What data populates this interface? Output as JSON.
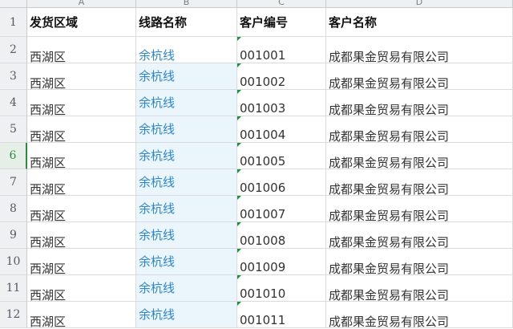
{
  "columns": [
    "A",
    "B",
    "C",
    "D"
  ],
  "headers": [
    "发货区域",
    "线路名称",
    "客户编号",
    "客户名称"
  ],
  "rows": [
    {
      "num": "2",
      "a": "西湖区",
      "b": "余杭线",
      "c": "001001",
      "d": "成都果金贸易有限公司"
    },
    {
      "num": "3",
      "a": "西湖区",
      "b": "余杭线",
      "c": "001002",
      "d": "成都果金贸易有限公司"
    },
    {
      "num": "4",
      "a": "西湖区",
      "b": "余杭线",
      "c": "001003",
      "d": "成都果金贸易有限公司"
    },
    {
      "num": "5",
      "a": "西湖区",
      "b": "余杭线",
      "c": "001004",
      "d": "成都果金贸易有限公司"
    },
    {
      "num": "6",
      "a": "西湖区",
      "b": "余杭线",
      "c": "001005",
      "d": "成都果金贸易有限公司"
    },
    {
      "num": "7",
      "a": "西湖区",
      "b": "余杭线",
      "c": "001006",
      "d": "成都果金贸易有限公司"
    },
    {
      "num": "8",
      "a": "西湖区",
      "b": "余杭线",
      "c": "001007",
      "d": "成都果金贸易有限公司"
    },
    {
      "num": "9",
      "a": "西湖区",
      "b": "余杭线",
      "c": "001008",
      "d": "成都果金贸易有限公司"
    },
    {
      "num": "10",
      "a": "西湖区",
      "b": "余杭线",
      "c": "001009",
      "d": "成都果金贸易有限公司"
    },
    {
      "num": "11",
      "a": "西湖区",
      "b": "余杭线",
      "c": "001010",
      "d": "成都果金贸易有限公司"
    },
    {
      "num": "12",
      "a": "西湖区",
      "b": "余杭线",
      "c": "001011",
      "d": "成都果金贸易有限公司"
    }
  ],
  "header_row_num": "1",
  "active_row": "6",
  "colors": {
    "selection": "#eaf5fc",
    "link_text": "#2f86c6",
    "active_header": "#2e8b3e",
    "number_marker": "#1f8f3a"
  }
}
